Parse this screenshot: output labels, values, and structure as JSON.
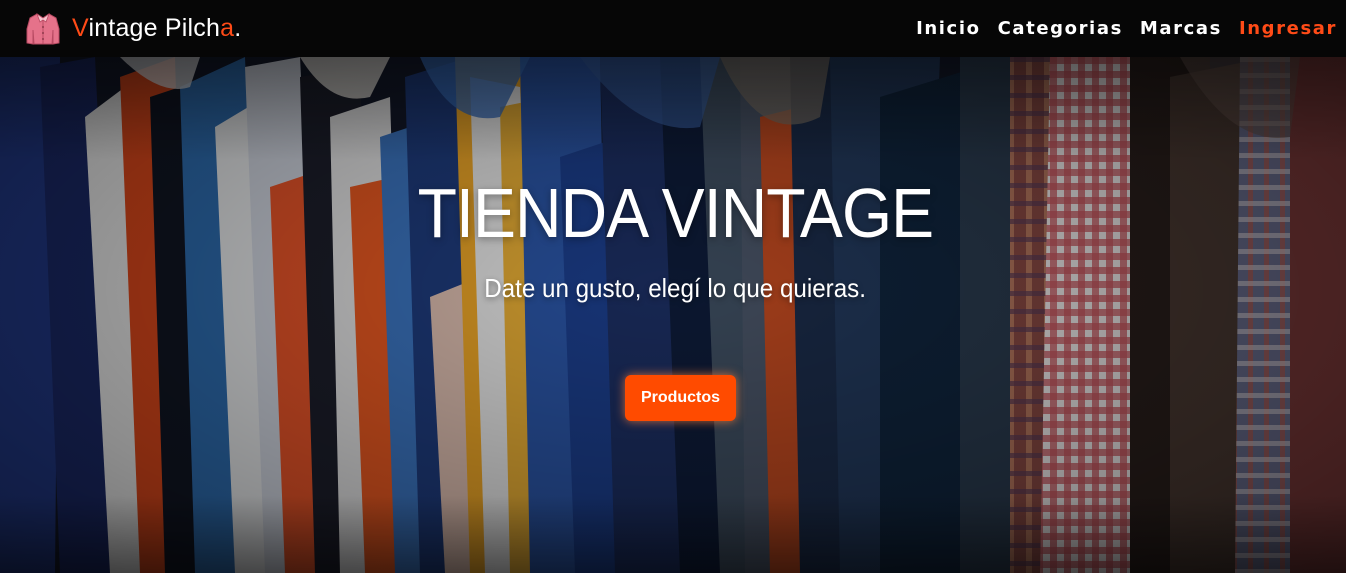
{
  "navbar": {
    "brand": {
      "first_letter": "V",
      "middle": "intage Pilch",
      "last_letter": "a",
      "dot": "."
    },
    "links": [
      {
        "label": "Inicio"
      },
      {
        "label": "Categorias"
      },
      {
        "label": "Marcas"
      },
      {
        "label": "Ingresar"
      }
    ]
  },
  "hero": {
    "title": "TIENDA VINTAGE",
    "subtitle": "Date un gusto, elegí lo que quieras.",
    "cta_label": "Productos"
  },
  "colors": {
    "accent": "#ff4b17",
    "button": "#ff4b00",
    "navbar_bg": "#060606"
  },
  "icons": {
    "logo": "shirt-logo-icon"
  }
}
